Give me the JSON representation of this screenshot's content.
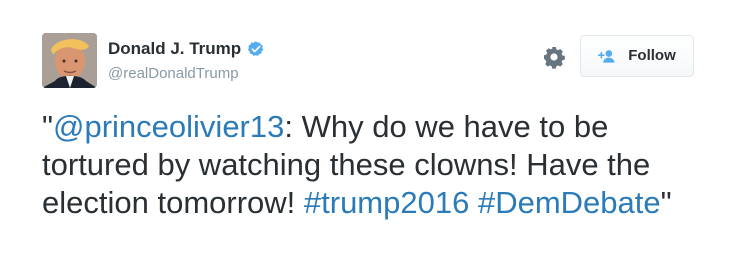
{
  "user": {
    "display_name": "Donald J. Trump",
    "handle": "@realDonaldTrump",
    "verified": true
  },
  "actions": {
    "follow_label": "Follow"
  },
  "tweet": {
    "quote_open": "\"",
    "mention": "@princeolivier13",
    "text_part1": ": Why do we have to be tortured by watching these clowns! Have the election tomorrow! ",
    "hashtag1": "#trump2016",
    "space": " ",
    "hashtag2": "#DemDebate",
    "quote_close": "\""
  },
  "icons": {
    "verified": "verified-badge-icon",
    "settings": "gear-icon",
    "follow": "add-user-icon"
  },
  "colors": {
    "link": "#2b7bb9",
    "verified": "#55acee",
    "text": "#292f33",
    "muted": "#8899a6"
  }
}
